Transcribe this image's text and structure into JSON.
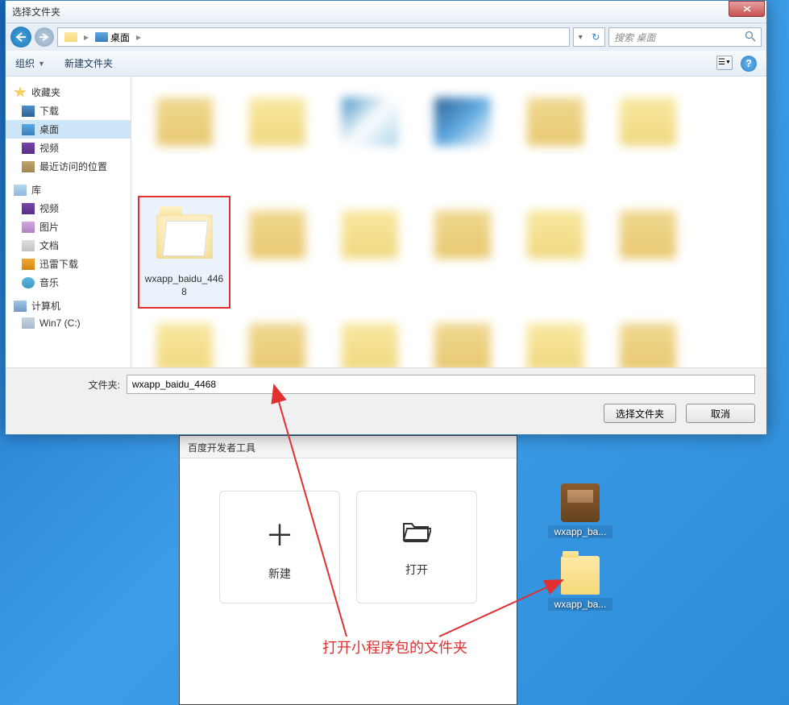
{
  "dialog": {
    "title": "选择文件夹",
    "address": {
      "location": "桌面"
    },
    "search": {
      "placeholder": "搜索 桌面"
    },
    "toolbar": {
      "organize": "组织",
      "newfolder": "新建文件夹"
    },
    "sidebar": {
      "favorites": "收藏夹",
      "downloads": "下载",
      "desktop": "桌面",
      "videos": "视频",
      "recent": "最近访问的位置",
      "libraries": "库",
      "lib_videos": "视频",
      "lib_pictures": "图片",
      "lib_documents": "文档",
      "lib_thunder": "迅雷下载",
      "lib_music": "音乐",
      "computer": "计算机",
      "drive_c": "Win7 (C:)"
    },
    "selected_folder": "wxapp_baidu_4468",
    "footer": {
      "label": "文件夹:",
      "value": "wxapp_baidu_4468",
      "select_btn": "选择文件夹",
      "cancel_btn": "取消"
    }
  },
  "devtool": {
    "title": "百度开发者工具",
    "new": "新建",
    "open": "打开"
  },
  "desktop": {
    "icon1": "wxapp_ba...",
    "icon2": "wxapp_ba..."
  },
  "annotation": "打开小程序包的文件夹"
}
